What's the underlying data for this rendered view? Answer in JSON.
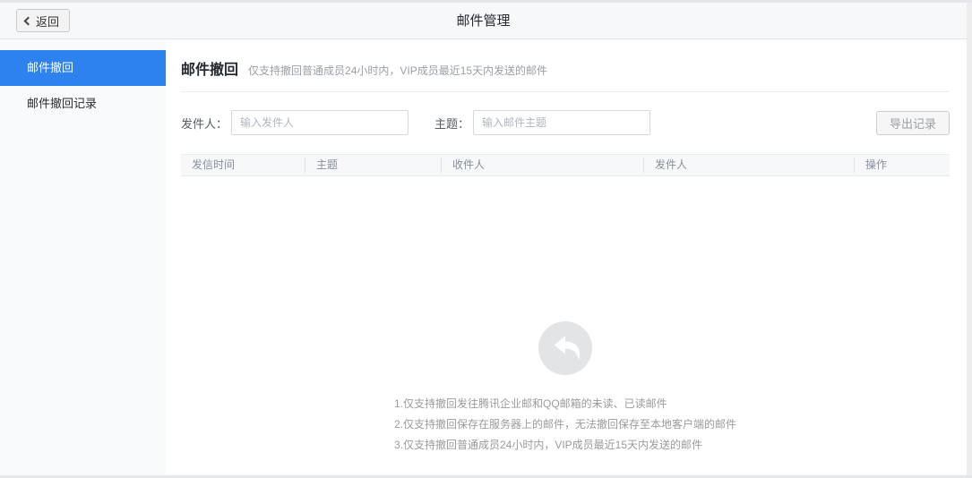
{
  "topbar": {
    "back_label": "返回",
    "title": "邮件管理"
  },
  "sidebar": {
    "items": [
      {
        "label": "邮件撤回",
        "active": true
      },
      {
        "label": "邮件撤回记录",
        "active": false
      }
    ]
  },
  "main": {
    "heading": "邮件撤回",
    "subtitle": "仅支持撤回普通成员24小时内，VIP成员最近15天内发送的邮件",
    "filters": {
      "sender_label": "发件人：",
      "sender_placeholder": "输入发件人",
      "sender_value": "",
      "subject_label": "主题：",
      "subject_placeholder": "输入邮件主题",
      "subject_value": "",
      "export_button": "导出记录"
    },
    "table": {
      "columns": [
        "发信时间",
        "主题",
        "收件人",
        "发件人",
        "操作"
      ],
      "rows": []
    },
    "empty": {
      "icon": "recall-arrow-icon",
      "notes": [
        "1.仅支持撤回发往腾讯企业邮和QQ邮箱的未读、已读邮件",
        "2.仅支持撤回保存在服务器上的邮件，无法撤回保存至本地客户端的邮件",
        "3.仅支持撤回普通成员24小时内，VIP成员最近15天内发送的邮件"
      ]
    }
  },
  "colors": {
    "accent": "#2e82f0",
    "topbar_bg": "#f7f8f9",
    "sidebar_bg": "#f9fafb",
    "empty_icon_fill": "#e3e4e6"
  }
}
